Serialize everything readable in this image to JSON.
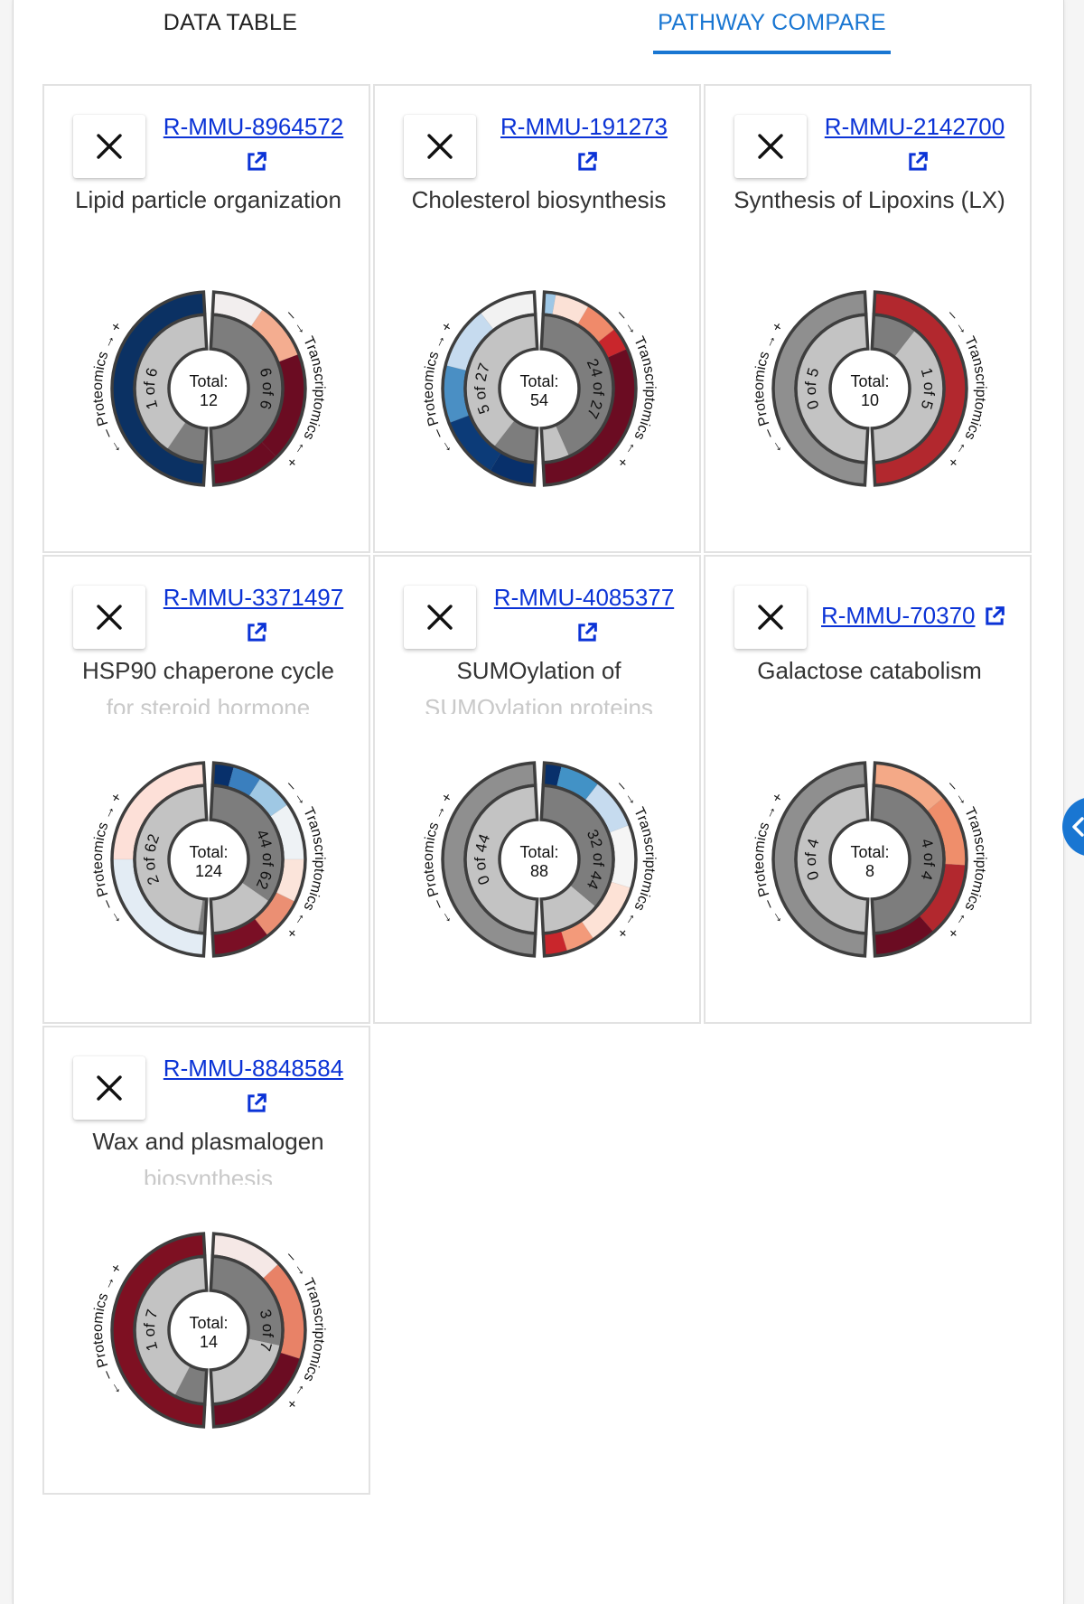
{
  "tabs": [
    {
      "label": "DATA TABLE",
      "active": false
    },
    {
      "label": "PATHWAY COMPARE",
      "active": true
    }
  ],
  "labels": {
    "proteomics": "Proteomics",
    "transcriptomics": "Transcriptomics",
    "total": "Total:"
  },
  "cards": [
    {
      "id": "R-MMU-8964572",
      "title": "Lipid particle organization",
      "subtitle": "",
      "total": "12",
      "left": "1 of 6",
      "right": "6 of 6"
    },
    {
      "id": "R-MMU-191273",
      "title": "Cholesterol biosynthesis",
      "subtitle": "",
      "total": "54",
      "left": "5 of 27",
      "right": "24 of 27"
    },
    {
      "id": "R-MMU-2142700",
      "title": "Synthesis of Lipoxins (LX)",
      "subtitle": "",
      "total": "10",
      "left": "0 of 5",
      "right": "1 of 5"
    },
    {
      "id": "R-MMU-3371497",
      "title": "HSP90 chaperone cycle",
      "subtitle": "for steroid hormone",
      "total": "124",
      "left": "2 of 62",
      "right": "44 of 62"
    },
    {
      "id": "R-MMU-4085377",
      "title": "SUMOylation of",
      "subtitle": "SUMOylation proteins",
      "total": "88",
      "left": "0 of 44",
      "right": "32 of 44"
    },
    {
      "id": "R-MMU-70370",
      "title": "Galactose catabolism",
      "subtitle": "",
      "total": "8",
      "left": "0 of 4",
      "right": "4 of 4"
    },
    {
      "id": "R-MMU-8848584",
      "title": "Wax and plasmalogen",
      "subtitle": "biosynthesis",
      "total": "14",
      "left": "1 of 7",
      "right": "3 of 7"
    }
  ],
  "colors": {
    "accent": "#1976d2",
    "link": "#0b33d6",
    "dark_red": "#6b0c22",
    "red": "#b2282e",
    "salmon": "#f4a987",
    "blue_dark": "#08306b",
    "blue_mid": "#4292c6",
    "blue_light": "#c6dbef"
  }
}
